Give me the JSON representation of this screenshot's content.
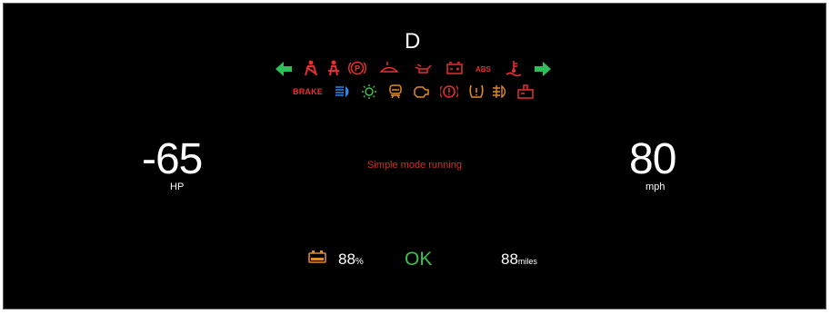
{
  "cluster": {
    "gear": "D",
    "power": {
      "value": "-65",
      "unit": "HP"
    },
    "speed": {
      "value": "80",
      "unit": "mph"
    },
    "status_message": "Simple mode running",
    "battery": {
      "percent": "88",
      "percent_unit": "%"
    },
    "system_status": "OK",
    "range": {
      "value": "88",
      "unit": "miles"
    }
  },
  "indicators": {
    "brake_label": "BRAKE",
    "abs_label": "ABS",
    "row1": [
      "turn-left-arrow",
      "seatbelt-icon",
      "seatbelt-2-icon",
      "parking-brake-icon",
      "washer-fluid-icon",
      "oil-pressure-icon",
      "battery-warning-icon",
      "abs-icon",
      "coolant-temp-icon",
      "turn-right-arrow"
    ],
    "row2": [
      "brake-warning-icon",
      "high-beam-icon",
      "light-on-icon",
      "seat-heater-icon",
      "engine-check-icon",
      "power-steering-icon",
      "tire-pressure-icon",
      "fog-light-icon",
      "glow-plug-icon"
    ]
  },
  "colors": {
    "background": "#000000",
    "warning_red": "#e53030",
    "amber": "#e08a2a",
    "green": "#3fbf4f",
    "blue": "#2f86e8"
  }
}
